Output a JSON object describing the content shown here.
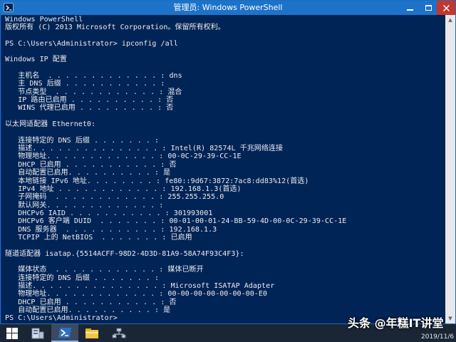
{
  "window": {
    "title": "管理员: Windows PowerShell"
  },
  "console": {
    "lines": [
      "Windows PowerShell",
      "版权所有 (C) 2013 Microsoft Corporation。保留所有权利。",
      "",
      "PS C:\\Users\\Administrator> ipconfig /all",
      "",
      "Windows IP 配置",
      "",
      "   主机名  . . . . . . . . . . . . . : dns",
      "   主 DNS 后缀 . . . . . . . . . . . :",
      "   节点类型  . . . . . . . . . . . . : 混合",
      "   IP 路由已启用 . . . . . . . . . . : 否",
      "   WINS 代理已启用 . . . . . . . . . : 否",
      "",
      "以太网适配器 Ethernet0:",
      "",
      "   连接特定的 DNS 后缀 . . . . . . . :",
      "   描述. . . . . . . . . . . . . . . : Intel(R) 82574L 千兆网络连接",
      "   物理地址. . . . . . . . . . . . . : 00-0C-29-39-CC-1E",
      "   DHCP 已启用 . . . . . . . . . . . : 否",
      "   自动配置已启用. . . . . . . . . . : 是",
      "   本地链接 IPv6 地址. . . . . . . . : fe80::9d67:3872:7ac8:dd83%12(首选)",
      "   IPv4 地址 . . . . . . . . . . . . : 192.168.1.3(首选)",
      "   子网掩码  . . . . . . . . . . . . : 255.255.255.0",
      "   默认网关. . . . . . . . . . . . . :",
      "   DHCPv6 IAID . . . . . . . . . . . : 301993001",
      "   DHCPv6 客户端 DUID  . . . . . . . : 00-01-00-01-24-BB-59-4D-00-0C-29-39-CC-1E",
      "   DNS 服务器  . . . . . . . . . . . : 192.168.1.3",
      "   TCPIP 上的 NetBIOS  . . . . . . . : 已启用",
      "",
      "隧道适配器 isatap.{5514ACFF-98D2-4D3D-81A9-58A74F93C4F3}:",
      "",
      "   媒体状态  . . . . . . . . . . . . : 媒体已断开",
      "   连接特定的 DNS 后缀 . . . . . . . :",
      "   描述. . . . . . . . . . . . . . . : Microsoft ISATAP Adapter",
      "   物理地址. . . . . . . . . . . . . : 00-00-00-00-00-00-00-E0",
      "   DHCP 已启用 . . . . . . . . . . . : 否",
      "   自动配置已启用. . . . . . . . . . : 是",
      "PS C:\\Users\\Administrator>"
    ]
  },
  "taskbar": {
    "icons": [
      "windows-start-icon",
      "server-manager-icon",
      "powershell-icon",
      "file-explorer-icon",
      "network-icon"
    ],
    "date": "2019/11/6"
  },
  "watermark": "头条 @年糕IT讲堂",
  "colors": {
    "console_bg": "#012456",
    "console_text": "#eeedf0",
    "titlebar": "#1d73c9",
    "close_button": "#c7362c",
    "taskbar": "#1a2535"
  }
}
